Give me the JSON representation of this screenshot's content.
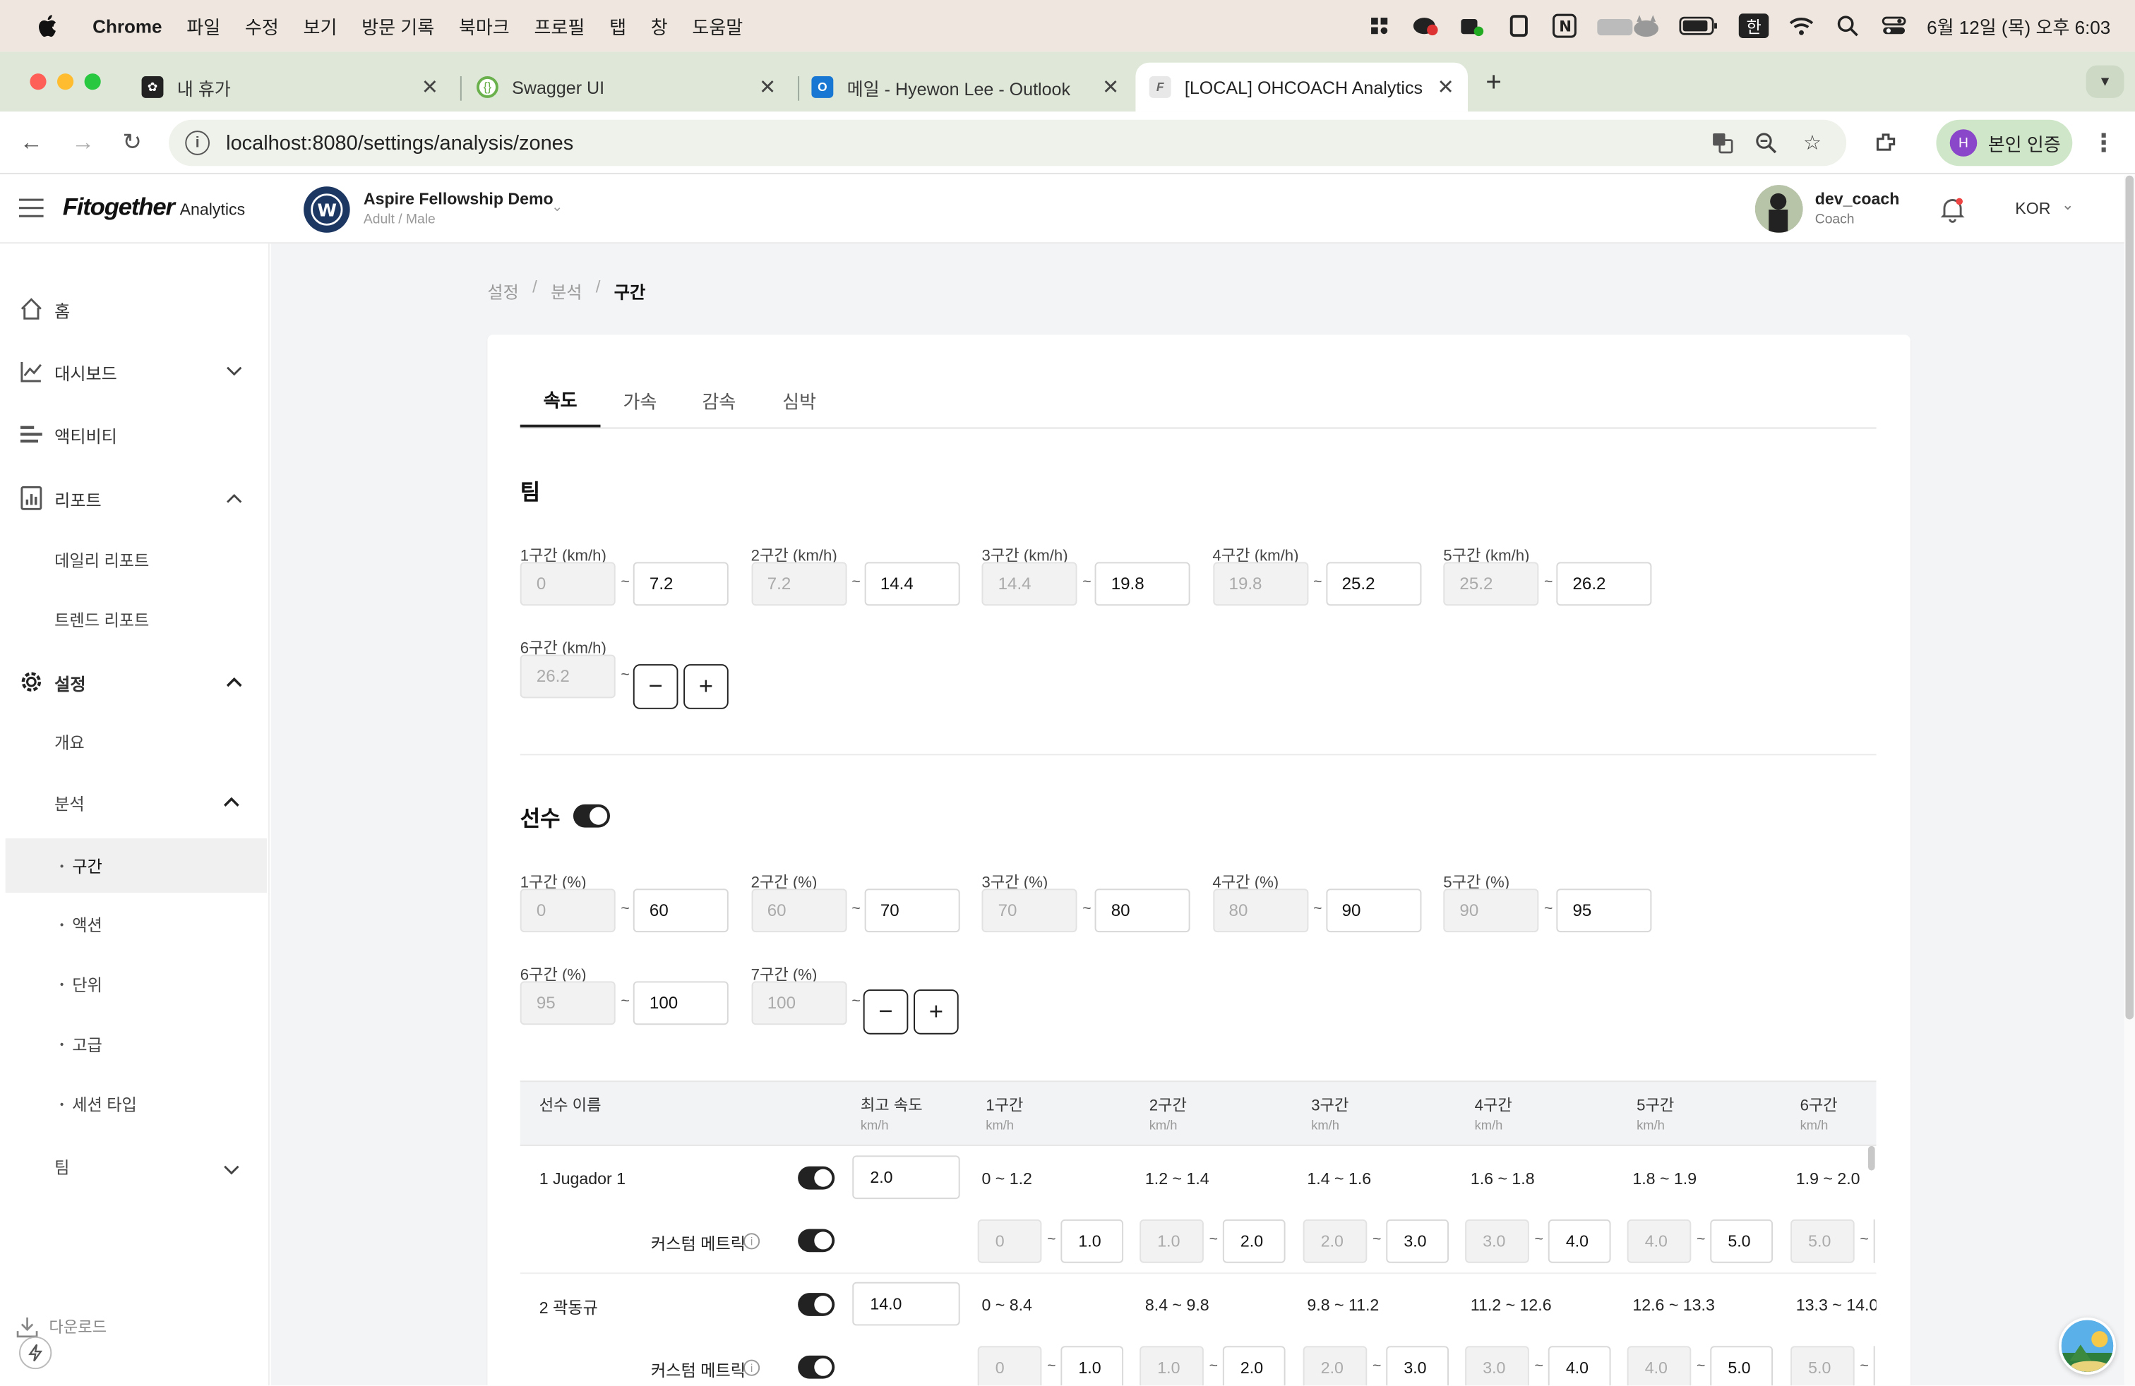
{
  "menubar": {
    "app": "Chrome",
    "menus": [
      "파일",
      "수정",
      "보기",
      "방문 기록",
      "북마크",
      "프로필",
      "탭",
      "창",
      "도움말"
    ],
    "ime": "한",
    "datetime": "6월 12일 (목) 오후 6:03"
  },
  "tabs": [
    {
      "title": "내 휴가"
    },
    {
      "title": "Swagger UI"
    },
    {
      "title": "메일 - Hyewon Lee - Outlook"
    },
    {
      "title": "[LOCAL] OHCOACH Analytics"
    }
  ],
  "address": {
    "url": "localhost:8080/settings/analysis/zones",
    "verify": "본인 인증",
    "profile_initial": "H"
  },
  "header": {
    "logo_main": "Fitogether",
    "logo_sub": "Analytics",
    "team_name": "Aspire Fellowship Demo",
    "team_sub": "Adult / Male",
    "user_name": "dev_coach",
    "user_role": "Coach",
    "lang": "KOR"
  },
  "sidebar": {
    "home": "홈",
    "dashboard": "대시보드",
    "activity": "액티비티",
    "report": "리포트",
    "daily_report": "데일리 리포트",
    "trend_report": "트렌드 리포트",
    "settings": "설정",
    "overview": "개요",
    "analysis": "분석",
    "zones": "구간",
    "action": "액션",
    "unit": "단위",
    "advanced": "고급",
    "session_type": "세션 타입",
    "team": "팀",
    "download": "다운로드"
  },
  "breadcrumb": [
    "설정",
    "분석",
    "구간"
  ],
  "content_tabs": [
    "속도",
    "가속",
    "감속",
    "심박"
  ],
  "team_section": {
    "title": "팀",
    "zones": [
      {
        "label": "1구간 (km/h)",
        "from": "0",
        "to": "7.2"
      },
      {
        "label": "2구간 (km/h)",
        "from": "7.2",
        "to": "14.4"
      },
      {
        "label": "3구간 (km/h)",
        "from": "14.4",
        "to": "19.8"
      },
      {
        "label": "4구간 (km/h)",
        "from": "19.8",
        "to": "25.2"
      },
      {
        "label": "5구간 (km/h)",
        "from": "25.2",
        "to": "26.2"
      },
      {
        "label": "6구간 (km/h)",
        "from": "26.2",
        "to": ""
      }
    ]
  },
  "player_section": {
    "title": "선수",
    "toggle_on": true,
    "zones": [
      {
        "label": "1구간 (%)",
        "from": "0",
        "to": "60"
      },
      {
        "label": "2구간 (%)",
        "from": "60",
        "to": "70"
      },
      {
        "label": "3구간 (%)",
        "from": "70",
        "to": "80"
      },
      {
        "label": "4구간 (%)",
        "from": "80",
        "to": "90"
      },
      {
        "label": "5구간 (%)",
        "from": "90",
        "to": "95"
      },
      {
        "label": "6구간 (%)",
        "from": "95",
        "to": "100"
      },
      {
        "label": "7구간 (%)",
        "from": "100",
        "to": ""
      }
    ]
  },
  "table": {
    "headers": {
      "name": "선수 이름",
      "max_speed": "최고 속도",
      "unit": "km/h",
      "zones": [
        "1구간",
        "2구간",
        "3구간",
        "4구간",
        "5구간",
        "6구간"
      ]
    },
    "custom_metric_label": "커스텀 메트릭",
    "rows": [
      {
        "name": "1 Jugador 1",
        "max_speed": "2.0",
        "ranges": [
          "0 ~ 1.2",
          "1.2 ~ 1.4",
          "1.4 ~ 1.6",
          "1.6 ~ 1.8",
          "1.8 ~ 1.9",
          "1.9 ~ 2.0"
        ],
        "custom": [
          [
            "0",
            "1.0"
          ],
          [
            "1.0",
            "2.0"
          ],
          [
            "2.0",
            "3.0"
          ],
          [
            "3.0",
            "4.0"
          ],
          [
            "4.0",
            "5.0"
          ],
          [
            "5.0",
            ""
          ]
        ]
      },
      {
        "name": "2 곽동규",
        "max_speed": "14.0",
        "ranges": [
          "0 ~ 8.4",
          "8.4 ~ 9.8",
          "9.8 ~ 11.2",
          "11.2 ~ 12.6",
          "12.6 ~ 13.3",
          "13.3 ~ 14.0"
        ],
        "custom": [
          [
            "0",
            "1.0"
          ],
          [
            "1.0",
            "2.0"
          ],
          [
            "2.0",
            "3.0"
          ],
          [
            "3.0",
            "4.0"
          ],
          [
            "4.0",
            "5.0"
          ],
          [
            "5.0",
            ""
          ]
        ]
      }
    ]
  },
  "glyphs": {
    "tilde": "~",
    "minus": "−",
    "plus": "+"
  },
  "colors": {
    "menubar": "#efe7df",
    "tabstrip": "#dfe8d8",
    "content_bg": "#f3f4f6",
    "toggle": "#222222"
  }
}
